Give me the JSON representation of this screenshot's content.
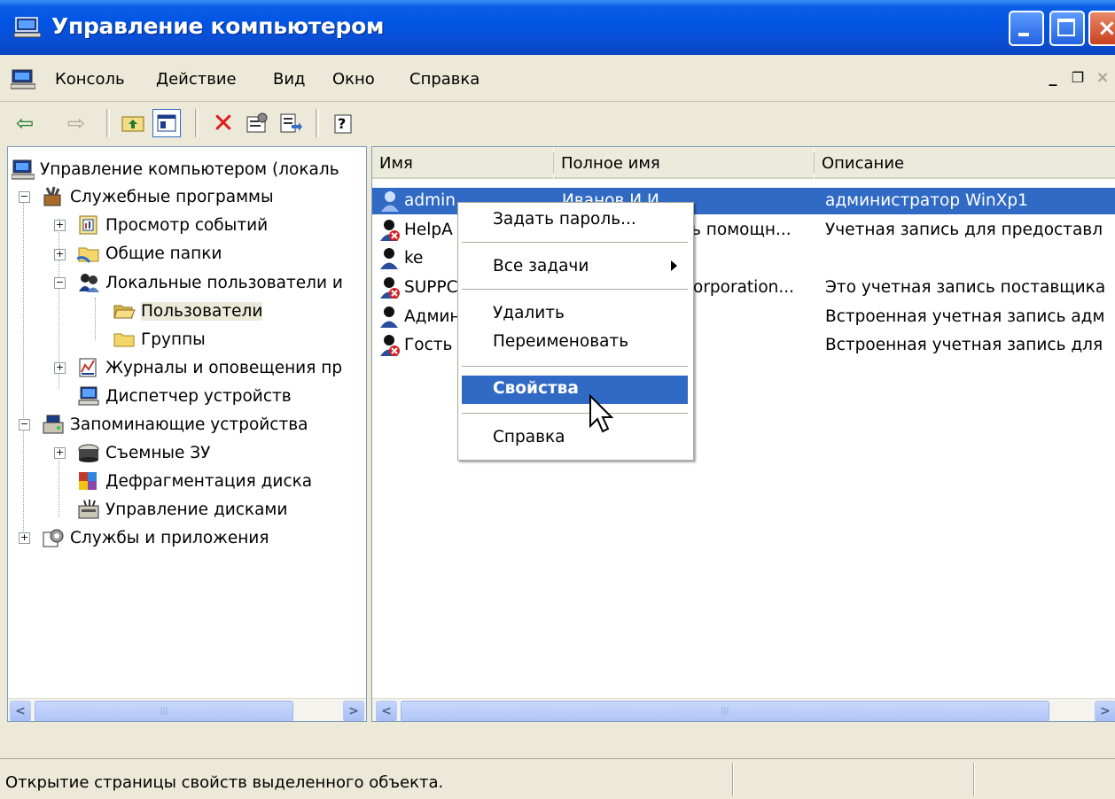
{
  "window": {
    "title": "Управление компьютером"
  },
  "menubar": {
    "items": [
      "Консоль",
      "Действие",
      "Вид",
      "Окно",
      "Справка"
    ]
  },
  "toolbar": {
    "buttons": [
      "back-icon",
      "forward-icon",
      "up-folder-icon",
      "show-tree-icon",
      "delete-icon",
      "properties-icon",
      "export-icon",
      "help-icon"
    ]
  },
  "tree": {
    "root": "Управление компьютером (локаль",
    "items": [
      {
        "label": "Служебные программы",
        "icon": "tools-icon"
      },
      {
        "label": "Просмотр событий",
        "icon": "event-viewer-icon"
      },
      {
        "label": "Общие папки",
        "icon": "shared-folders-icon"
      },
      {
        "label": "Локальные пользователи и",
        "icon": "local-users-icon"
      },
      {
        "label": "Пользователи",
        "icon": "folder-open-icon"
      },
      {
        "label": "Группы",
        "icon": "folder-icon"
      },
      {
        "label": "Журналы и оповещения пр",
        "icon": "perf-logs-icon"
      },
      {
        "label": "Диспетчер устройств",
        "icon": "device-manager-icon"
      },
      {
        "label": "Запоминающие устройства",
        "icon": "storage-icon"
      },
      {
        "label": "Съемные ЗУ",
        "icon": "removable-storage-icon"
      },
      {
        "label": "Дефрагментация диска",
        "icon": "defrag-icon"
      },
      {
        "label": "Управление дисками",
        "icon": "disk-management-icon"
      },
      {
        "label": "Службы и приложения",
        "icon": "services-icon"
      }
    ]
  },
  "list": {
    "columns": [
      "Имя",
      "Полное имя",
      "Описание"
    ],
    "rows": [
      {
        "name": "admin",
        "full": "Иванов И.И.",
        "desc": "администратор WinXp1"
      },
      {
        "name": "HelpA",
        "full": "ь помощн...",
        "desc": "Учетная запись для предоставл"
      },
      {
        "name": "ke",
        "full": "",
        "desc": ""
      },
      {
        "name": "SUPPC",
        "full": "orporation...",
        "desc": "Это учетная запись поставщика"
      },
      {
        "name": "Админ",
        "full": "",
        "desc": "Встроенная учетная запись адм"
      },
      {
        "name": "Гость",
        "full": "",
        "desc": "Встроенная учетная запись для"
      }
    ]
  },
  "context_menu": {
    "items": [
      "Задать пароль...",
      "Все задачи",
      "Удалить",
      "Переименовать",
      "Свойства",
      "Справка"
    ],
    "highlighted": "Свойства"
  },
  "status": {
    "text": "Открытие страницы свойств выделенного объекта."
  },
  "colors": {
    "selection": "#316ac5",
    "titlebar": "#0054e3",
    "face": "#ece9d8"
  }
}
